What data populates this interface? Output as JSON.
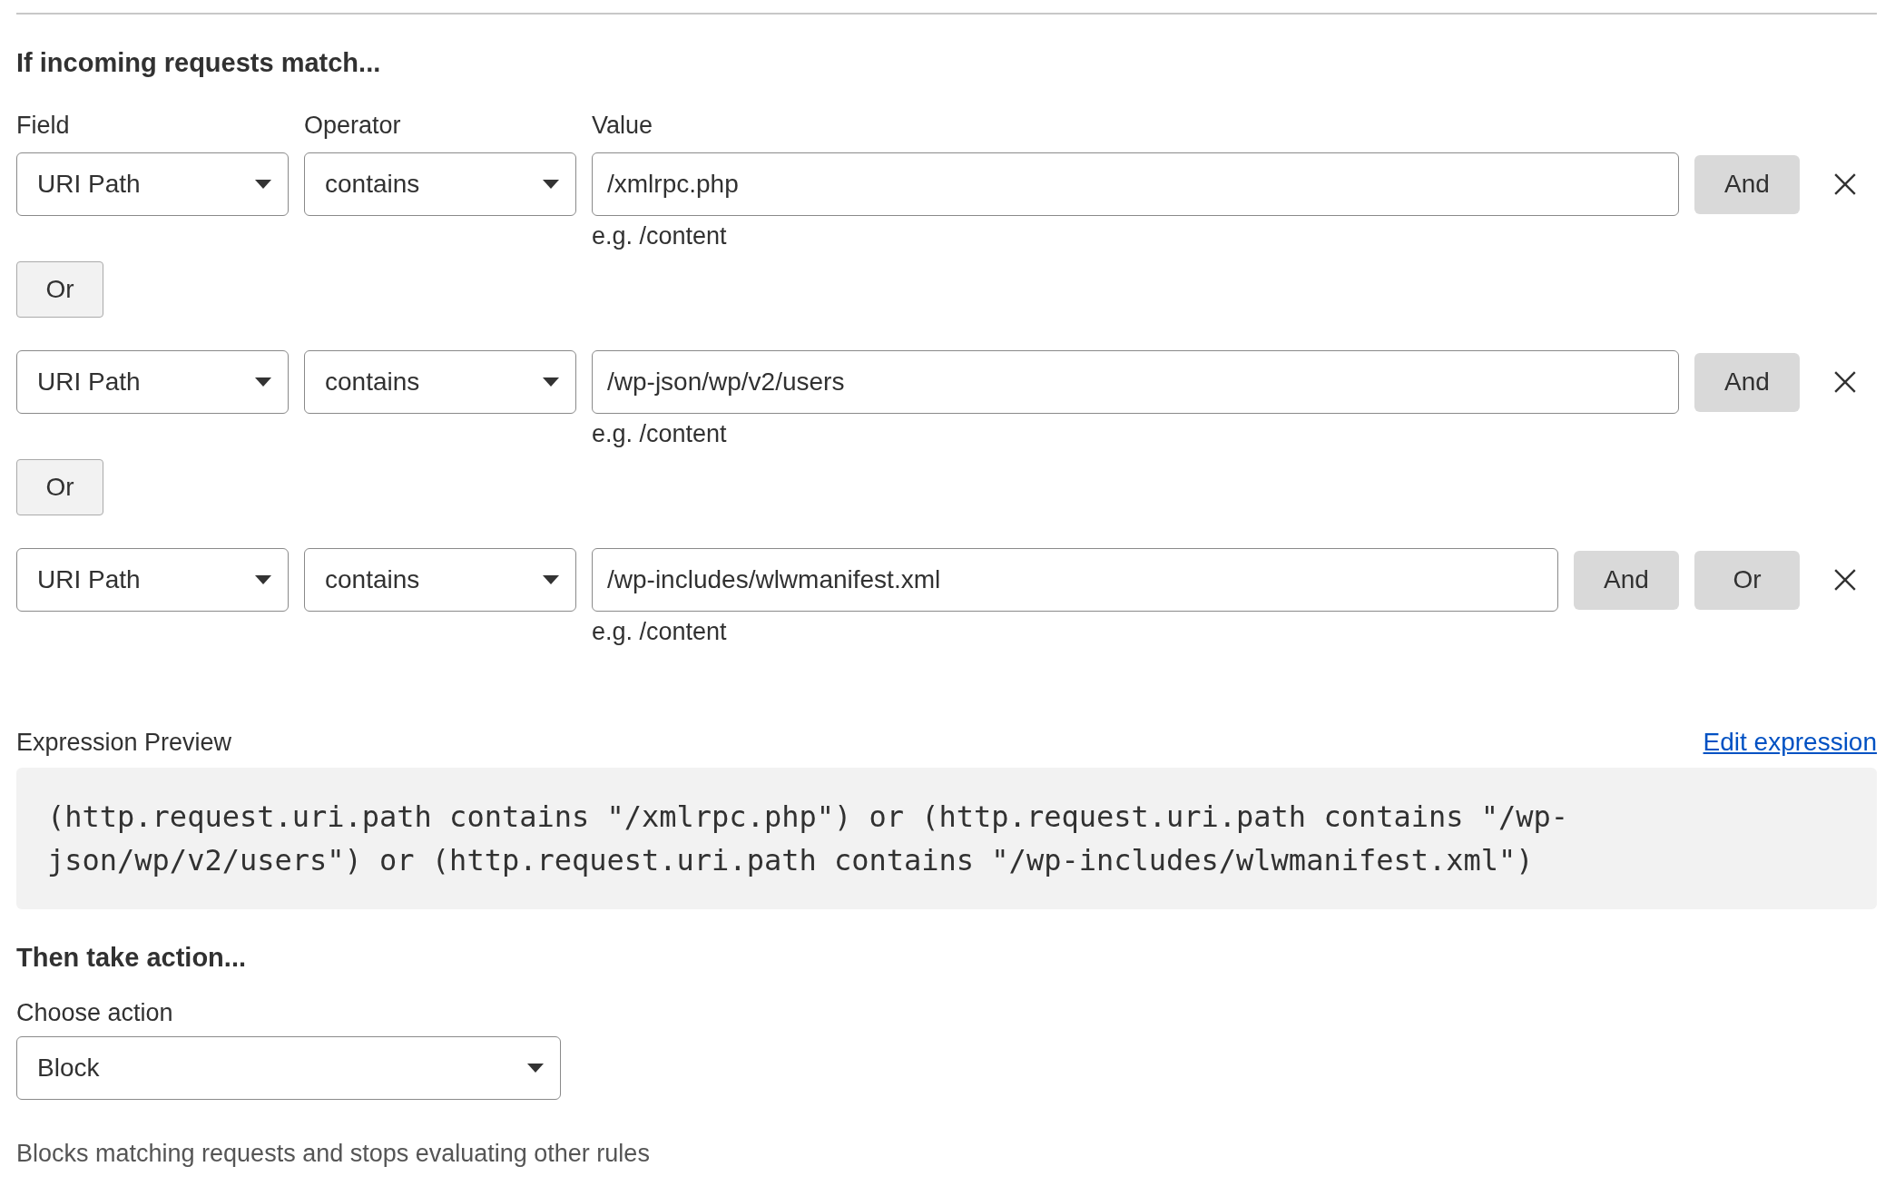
{
  "match_section": {
    "heading": "If incoming requests match...",
    "columns": [
      "Field",
      "Operator",
      "Value"
    ],
    "conditions": [
      {
        "field": "URI Path",
        "operator": "contains",
        "value": "/xmlrpc.php",
        "hint": "e.g. /content",
        "buttons": [
          "And"
        ],
        "or_below": "Or"
      },
      {
        "field": "URI Path",
        "operator": "contains",
        "value": "/wp-json/wp/v2/users",
        "hint": "e.g. /content",
        "buttons": [
          "And"
        ],
        "or_below": "Or"
      },
      {
        "field": "URI Path",
        "operator": "contains",
        "value": "/wp-includes/wlwmanifest.xml",
        "hint": "e.g. /content",
        "buttons": [
          "And",
          "Or"
        ]
      }
    ]
  },
  "expression_preview": {
    "label": "Expression Preview",
    "link": "Edit expression",
    "code": "(http.request.uri.path contains \"/xmlrpc.php\") or (http.request.uri.path contains \"/wp-json/wp/v2/users\") or (http.request.uri.path contains \"/wp-includes/wlwmanifest.xml\")"
  },
  "action_section": {
    "heading": "Then take action...",
    "label": "Choose action",
    "value": "Block",
    "description": "Blocks matching requests and stops evaluating other rules"
  }
}
